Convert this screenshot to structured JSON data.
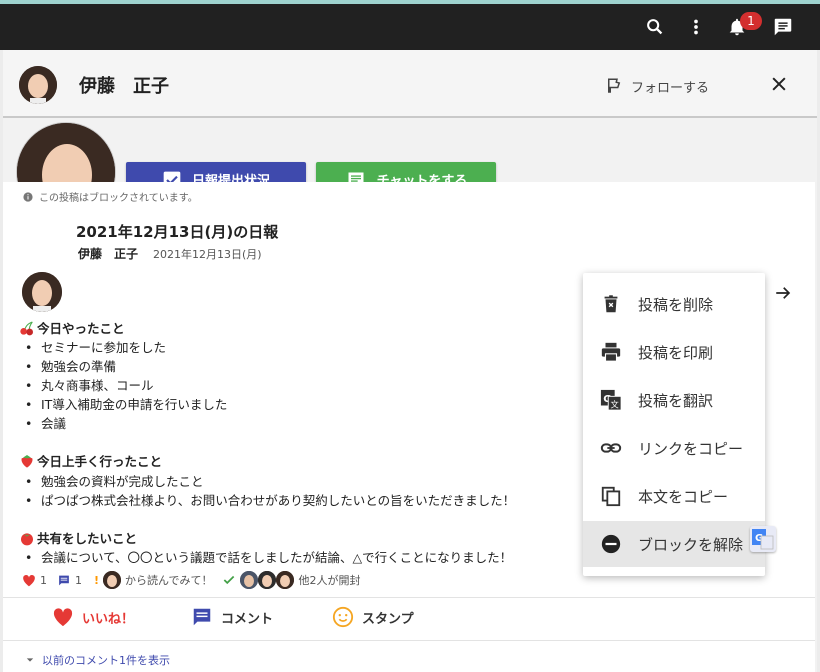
{
  "topbar": {
    "notification_count": "1"
  },
  "header": {
    "user_name": "伊藤　正子",
    "follow_label": "フォローする"
  },
  "profile": {
    "report_status_button": "日報提出状況",
    "chat_button": "チャットをする"
  },
  "post": {
    "blocked_notice": "この投稿はブロックされています。",
    "title": "2021年12月13日(月)の日報",
    "author": "伊藤　正子",
    "date": "2021年12月13日(月)",
    "sections": [
      {
        "icon": "cherry-icon",
        "heading": "今日やったこと",
        "items": [
          "セミナーに参加をした",
          "勉強会の準備",
          "丸々商事様、コール",
          "IT導入補助金の申請を行いました",
          "会議"
        ]
      },
      {
        "icon": "strawberry-icon",
        "heading": "今日上手く行ったこと",
        "items": [
          "勉強会の資料が完成したこと",
          "ぱつぱつ株式会社様より、お問い合わせがあり契約したいとの旨をいただきました！"
        ]
      },
      {
        "icon": "tomato-icon",
        "heading": "共有をしたいこと",
        "items": [
          "会議について、〇〇という議題で話をしましたが結論、△で行くことになりました！"
        ]
      }
    ],
    "meta": {
      "likes": "1",
      "comments": "1",
      "read_request": "から読んでみて！",
      "opened_text": "他2人が開封"
    },
    "actions": {
      "like": "いいね！",
      "comment": "コメント",
      "stamp": "スタンプ"
    },
    "prev_comments": "以前のコメント1件を表示"
  },
  "menu": {
    "items": [
      {
        "label": "投稿を削除",
        "icon": "trash-icon"
      },
      {
        "label": "投稿を印刷",
        "icon": "print-icon"
      },
      {
        "label": "投稿を翻訳",
        "icon": "translate-icon"
      },
      {
        "label": "リンクをコピー",
        "icon": "link-icon"
      },
      {
        "label": "本文をコピー",
        "icon": "copy-icon"
      },
      {
        "label": "ブロックを解除",
        "icon": "unblock-icon"
      }
    ]
  },
  "colors": {
    "topbar": "#212121",
    "primary": "#3f4aad",
    "success": "#4caf50",
    "like_red": "#e53935",
    "badge_red": "#d32f2f"
  }
}
